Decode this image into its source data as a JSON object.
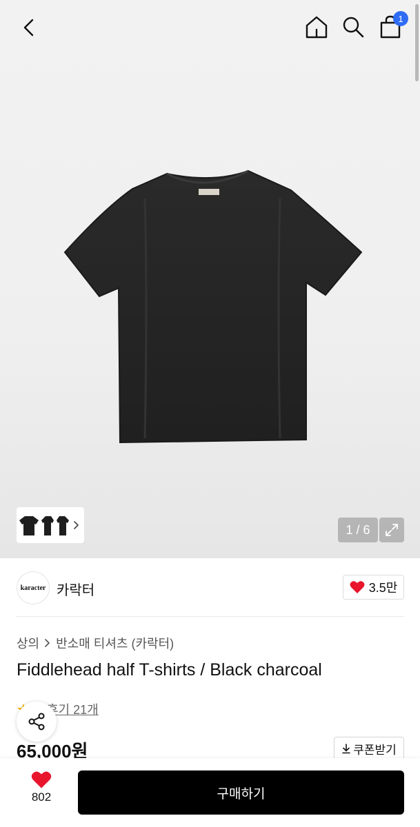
{
  "header": {
    "back_icon": "chevron-left-icon",
    "home_icon": "home-icon",
    "search_icon": "search-icon",
    "cart_icon": "shopping-bag-icon",
    "cart_count": "1",
    "badge_color": "#2f6cf4"
  },
  "gallery": {
    "counter": "1 / 6",
    "expand_icon": "expand-icon"
  },
  "brand": {
    "logo_text": "karacter",
    "name": "카락터",
    "likes": "3.5만"
  },
  "breadcrumb": {
    "items": [
      "상의",
      "반소매 티셔츠 (카락터)"
    ]
  },
  "product": {
    "title": "Fiddlehead half T-shirts / Black charcoal",
    "review_text": "후기 21개",
    "price": "65,000원",
    "coupon_label": "쿠폰받기"
  },
  "bottom": {
    "wish_count": "802",
    "buy_label": "구매하기",
    "heart_color": "#e8152d"
  }
}
